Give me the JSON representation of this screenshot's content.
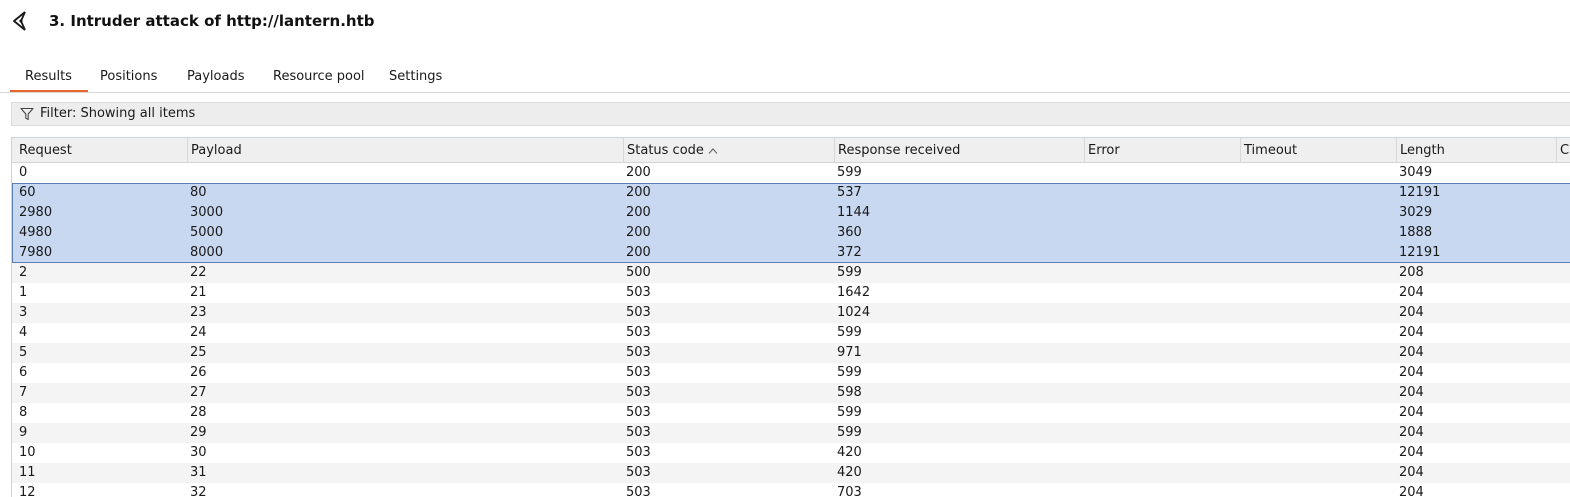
{
  "window": {
    "title": "3. Intruder attack of http://lantern.htb"
  },
  "tabs": [
    {
      "label": "Results",
      "active": true
    },
    {
      "label": "Positions",
      "active": false
    },
    {
      "label": "Payloads",
      "active": false
    },
    {
      "label": "Resource pool",
      "active": false
    },
    {
      "label": "Settings",
      "active": false
    }
  ],
  "filter": {
    "label": "Filter: Showing all items"
  },
  "table": {
    "columns": [
      "Request",
      "Payload",
      "Status code",
      "Response received",
      "Error",
      "Timeout",
      "Length",
      "C"
    ],
    "sorted_column": "Status code",
    "sort_direction": "ascending",
    "rows": [
      [
        "0",
        "",
        "200",
        "599",
        "",
        "",
        "3049"
      ],
      [
        "60",
        "80",
        "200",
        "537",
        "",
        "",
        "12191"
      ],
      [
        "2980",
        "3000",
        "200",
        "1144",
        "",
        "",
        "3029"
      ],
      [
        "4980",
        "5000",
        "200",
        "360",
        "",
        "",
        "1888"
      ],
      [
        "7980",
        "8000",
        "200",
        "372",
        "",
        "",
        "12191"
      ],
      [
        "2",
        "22",
        "500",
        "599",
        "",
        "",
        "208"
      ],
      [
        "1",
        "21",
        "503",
        "1642",
        "",
        "",
        "204"
      ],
      [
        "3",
        "23",
        "503",
        "1024",
        "",
        "",
        "204"
      ],
      [
        "4",
        "24",
        "503",
        "599",
        "",
        "",
        "204"
      ],
      [
        "5",
        "25",
        "503",
        "971",
        "",
        "",
        "204"
      ],
      [
        "6",
        "26",
        "503",
        "599",
        "",
        "",
        "204"
      ],
      [
        "7",
        "27",
        "503",
        "598",
        "",
        "",
        "204"
      ],
      [
        "8",
        "28",
        "503",
        "599",
        "",
        "",
        "204"
      ],
      [
        "9",
        "29",
        "503",
        "599",
        "",
        "",
        "204"
      ],
      [
        "10",
        "30",
        "503",
        "420",
        "",
        "",
        "204"
      ],
      [
        "11",
        "31",
        "503",
        "420",
        "",
        "",
        "204"
      ],
      [
        "12",
        "32",
        "503",
        "703",
        "",
        "",
        "204"
      ]
    ],
    "selected_rows": [
      1,
      2,
      3,
      4
    ]
  },
  "colors": {
    "accent": "#e8662b",
    "selection": "#c8d8f0",
    "selection_border": "#5d7fb5"
  },
  "icons": {
    "app": "burp-intruder-icon",
    "filter": "funnel-icon",
    "sort": "sort-ascending-icon"
  }
}
